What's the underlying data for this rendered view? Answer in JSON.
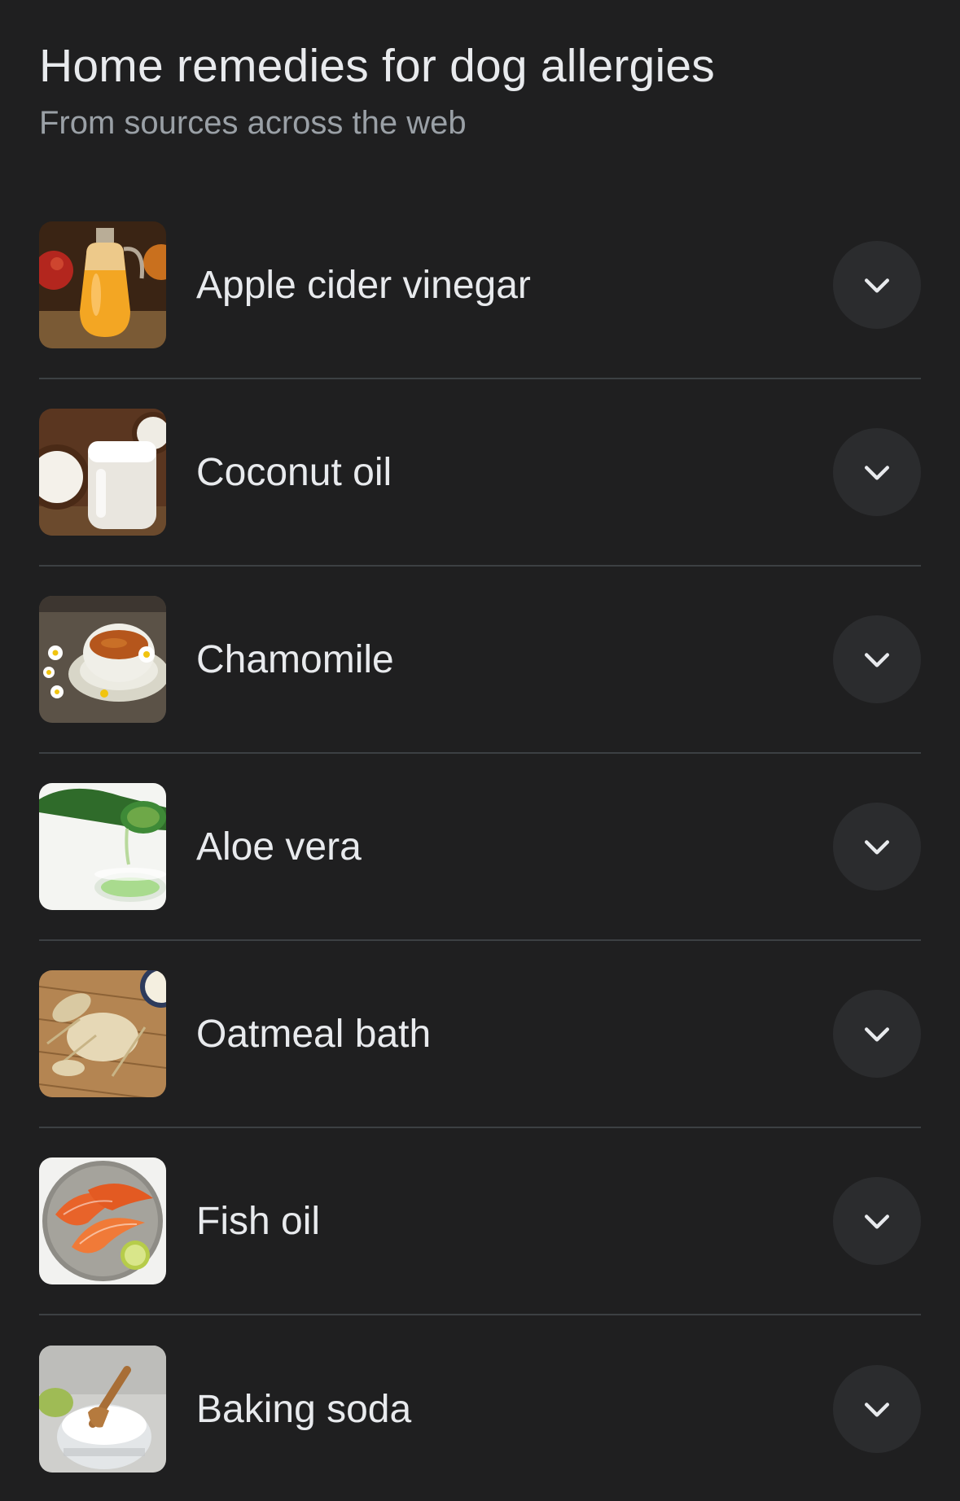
{
  "header": {
    "title": "Home remedies for dog allergies",
    "subtitle": "From sources across the web"
  },
  "items": [
    {
      "label": "Apple cider vinegar",
      "icon": "chevron-down-icon"
    },
    {
      "label": "Coconut oil",
      "icon": "chevron-down-icon"
    },
    {
      "label": "Chamomile",
      "icon": "chevron-down-icon"
    },
    {
      "label": "Aloe vera",
      "icon": "chevron-down-icon"
    },
    {
      "label": "Oatmeal bath",
      "icon": "chevron-down-icon"
    },
    {
      "label": "Fish oil",
      "icon": "chevron-down-icon"
    },
    {
      "label": "Baking soda",
      "icon": "chevron-down-icon"
    }
  ],
  "colors": {
    "background": "#1f1f20",
    "text": "#e8eaed",
    "subtext": "#9aa0a6",
    "divider": "#3c4043",
    "button": "#2b2c2e"
  }
}
